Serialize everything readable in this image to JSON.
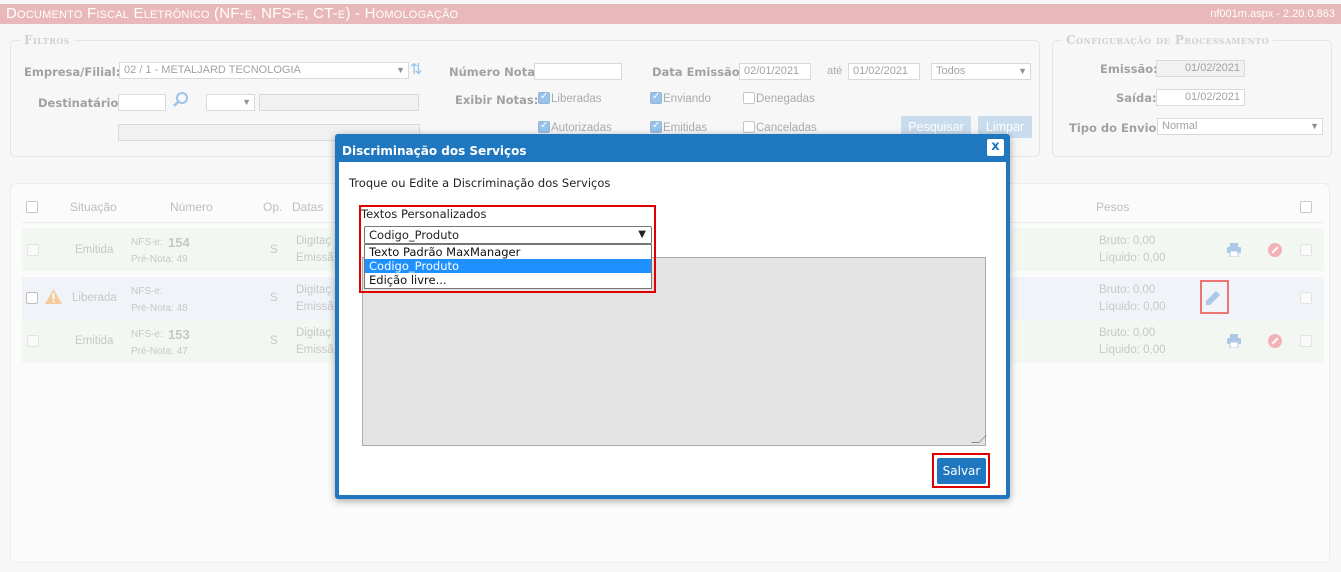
{
  "titlebar": {
    "title": "Documento Fiscal Eletrônico (NF-e, NFS-e, CT-e)  - Homologação",
    "version": "nf001m.aspx - 2.20.0.863"
  },
  "filters": {
    "legend": "Filtros",
    "empresa_label": "Empresa/Filial:",
    "empresa_value": "02 / 1 - METALJARD TECNOLOGIA",
    "destinatario_label": "Destinatário:",
    "numero_nota_label": "Número Nota:",
    "data_emissao_label": "Data Emissão:",
    "data_from": "02/01/2021",
    "ate_label": "até",
    "data_to": "01/02/2021",
    "periodo_select": "Todos",
    "exibir_label": "Exibir Notas:",
    "checks": {
      "liberadas": "Liberadas",
      "enviando": "Enviando",
      "denegadas": "Denegadas",
      "autorizadas": "Autorizadas",
      "emitidas": "Emitidas",
      "canceladas": "Canceladas"
    },
    "pesquisar": "Pesquisar",
    "limpar": "Limpar"
  },
  "config": {
    "legend": "Configuração de Processamento",
    "emissao_label": "Emissão:",
    "emissao_value": "01/02/2021",
    "saida_label": "Saída:",
    "saida_value": "01/02/2021",
    "tipo_label": "Tipo do Envio:",
    "tipo_value": "Normal"
  },
  "grid": {
    "headers": {
      "situacao": "Situação",
      "numero": "Número",
      "op": "Op.",
      "datas": "Datas",
      "pesos": "Pesos"
    },
    "rows": [
      {
        "situacao": "Emitida",
        "doc": "NFS-e:",
        "numero": "154",
        "pre": "Pré-Nota: 49",
        "op": "S",
        "d1": "Digitaç",
        "d2": "Emissã",
        "bruto": "Bruto: 0,00",
        "liquido": "Líquido: 0,00"
      },
      {
        "situacao": "Liberada",
        "doc": "NFS-e:",
        "numero": "",
        "pre": "Pré-Nota: 48",
        "op": "S",
        "d1": "Digitaç",
        "d2": "Emissã",
        "bruto": "Bruto: 0,00",
        "liquido": "Líquido: 0,00"
      },
      {
        "situacao": "Emitida",
        "doc": "NFS-e:",
        "numero": "153",
        "pre": "Pré-Nota: 47",
        "op": "S",
        "d1": "Digitaç",
        "d2": "Emissã",
        "bruto": "Bruto: 0,00",
        "liquido": "Líquido: 0,00"
      }
    ]
  },
  "modal": {
    "title": "Discriminação dos Serviços",
    "close": "x",
    "subtitle": "Troque ou Edite a Discriminação dos Serviços",
    "select_label": "Textos Personalizados",
    "select_value": "Codigo_Produto",
    "options": [
      "Texto Padrão MaxManager",
      "Codigo_Produto",
      "Edição livre..."
    ],
    "selected_index": 1,
    "save": "Salvar"
  },
  "colors": {
    "titlebar": "#d87f82",
    "modal_blue": "#1f78bf",
    "highlight_red": "#e00000"
  }
}
